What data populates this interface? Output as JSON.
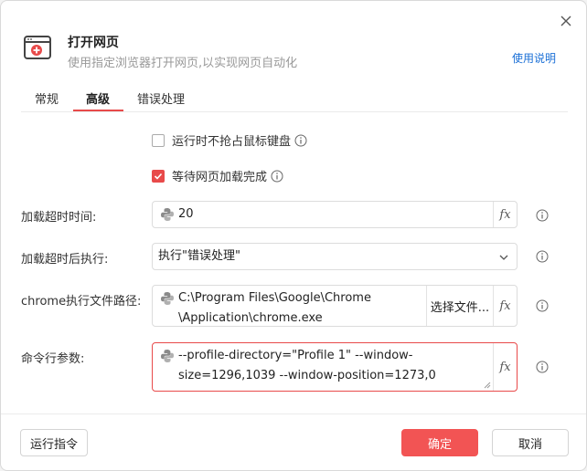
{
  "header": {
    "title": "打开网页",
    "subtitle": "使用指定浏览器打开网页,以实现网页自动化",
    "help_link": "使用说明"
  },
  "tabs": [
    {
      "label": "常规",
      "active": false
    },
    {
      "label": "高级",
      "active": true
    },
    {
      "label": "错误处理",
      "active": false
    }
  ],
  "options": {
    "no_grab_mouse": {
      "label": "运行时不抢占鼠标键盘",
      "checked": false
    },
    "wait_page_load": {
      "label": "等待网页加载完成",
      "checked": true
    }
  },
  "fields": {
    "timeout": {
      "label": "加载超时时间:",
      "value": "20"
    },
    "on_timeout": {
      "label": "加载超时后执行:",
      "value": "执行\"错误处理\""
    },
    "chrome_path": {
      "label": "chrome执行文件路径:",
      "value_line1": "C:\\Program Files\\Google\\Chrome",
      "value_line2": "\\Application\\chrome.exe",
      "choose_file": "选择文件..."
    },
    "cmd_args": {
      "label": "命令行参数:",
      "value_line1": "--profile-directory=\"Profile 1\" --window-",
      "value_line2": "size=1296,1039 --window-position=1273,0"
    }
  },
  "fx_label": "fx",
  "footer": {
    "run_command": "运行指令",
    "confirm": "确定",
    "cancel": "取消"
  },
  "colors": {
    "accent": "#e84a4a",
    "primary_button": "#f25454",
    "link": "#1a6fd6"
  },
  "icons": {
    "header": "browser-open-icon",
    "close": "close-icon",
    "info": "info-icon",
    "python": "python-icon",
    "dropdown": "chevron-down-icon",
    "resize": "resize-handle-icon"
  }
}
